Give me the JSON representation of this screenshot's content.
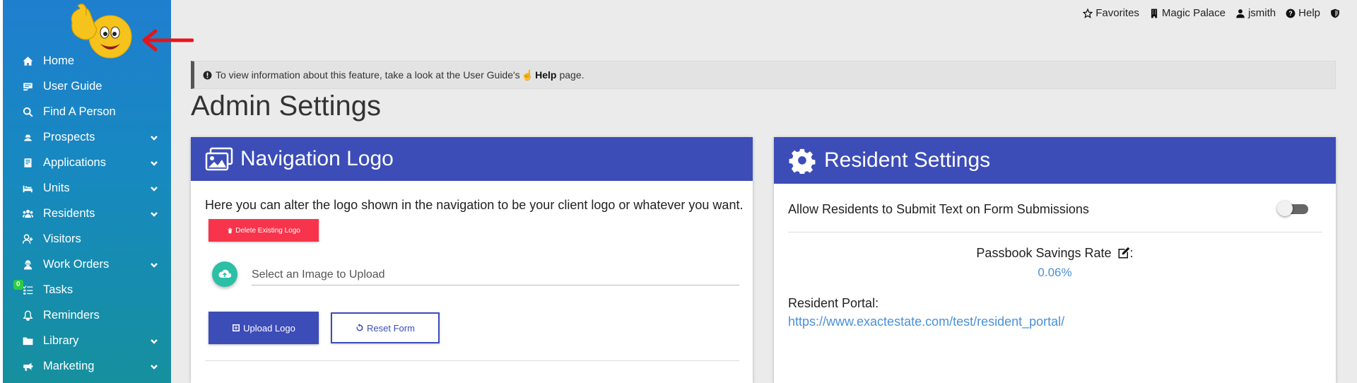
{
  "topbar": {
    "favorites": "Favorites",
    "property": "Magic Palace",
    "user": "jsmith",
    "help": "Help"
  },
  "sidebar": {
    "items": [
      {
        "label": "Home",
        "icon": "home-icon",
        "chevron": false
      },
      {
        "label": "User Guide",
        "icon": "user-guide-icon",
        "chevron": false
      },
      {
        "label": "Find A Person",
        "icon": "search-icon",
        "chevron": false
      },
      {
        "label": "Prospects",
        "icon": "prospects-icon",
        "chevron": true
      },
      {
        "label": "Applications",
        "icon": "applications-icon",
        "chevron": true
      },
      {
        "label": "Units",
        "icon": "bed-icon",
        "chevron": true
      },
      {
        "label": "Residents",
        "icon": "residents-icon",
        "chevron": true
      },
      {
        "label": "Visitors",
        "icon": "user-plus-icon",
        "chevron": false
      },
      {
        "label": "Work Orders",
        "icon": "worker-icon",
        "chevron": true
      },
      {
        "label": "Tasks",
        "icon": "tasks-icon",
        "chevron": false,
        "badge": "0"
      },
      {
        "label": "Reminders",
        "icon": "bell-icon",
        "chevron": false
      },
      {
        "label": "Library",
        "icon": "folder-icon",
        "chevron": true
      },
      {
        "label": "Marketing",
        "icon": "marketing-icon",
        "chevron": true
      }
    ]
  },
  "info": {
    "text_before": "To view information about this feature, take a look at the User Guide's",
    "help_word": "Help",
    "text_after": "page."
  },
  "page_title": "Admin Settings",
  "nav_logo_card": {
    "title": "Navigation Logo",
    "description": "Here you can alter the logo shown in the navigation to be your client logo or whatever you want.",
    "delete_label": "Delete Existing Logo",
    "file_placeholder": "Select an Image to Upload",
    "upload_label": "Upload Logo",
    "reset_label": "Reset Form"
  },
  "resident_card": {
    "title": "Resident Settings",
    "allow_text_label": "Allow Residents to Submit Text on Form Submissions",
    "allow_text_enabled": false,
    "rate_label": "Passbook Savings Rate",
    "rate_suffix": ":",
    "rate_value": "0.06%",
    "portal_label": "Resident Portal:",
    "portal_url": "https://www.exactestate.com/test/resident_portal/"
  },
  "colors": {
    "header_blue": "#3c4db8",
    "delete_red": "#f7344b",
    "upload_teal": "#2bbfa6",
    "link_blue": "#4a90d9"
  }
}
